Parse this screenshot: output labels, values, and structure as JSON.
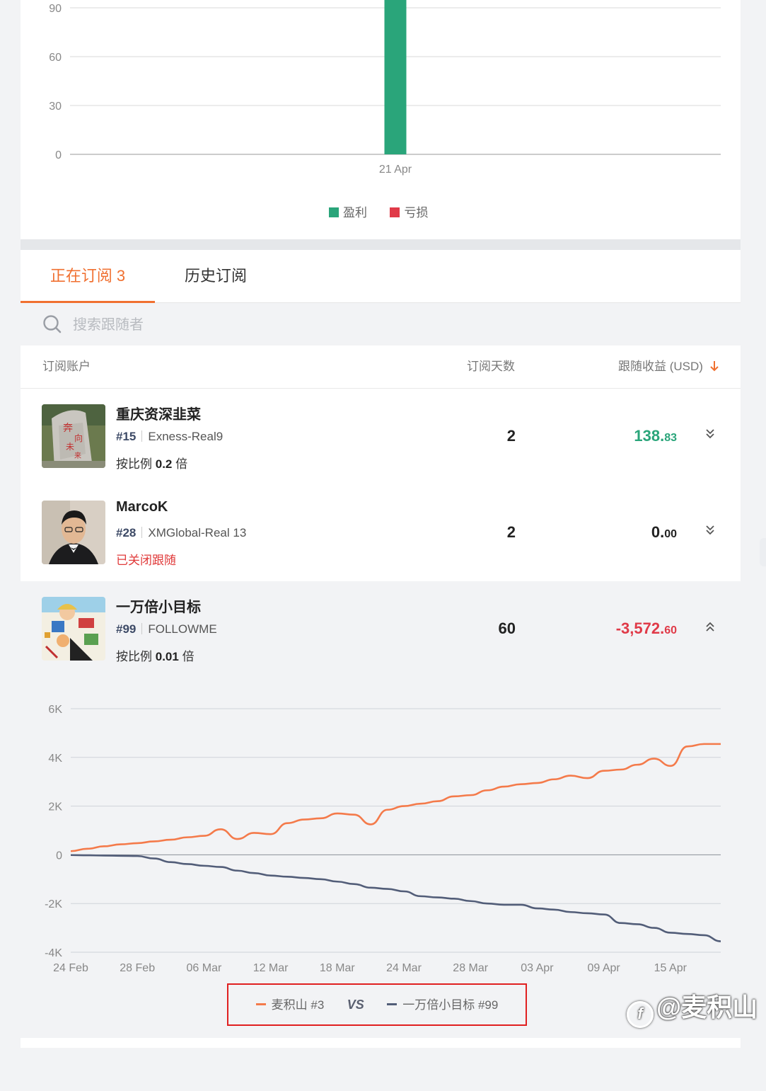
{
  "top_chart": {
    "y_ticks": [
      "90",
      "60",
      "30",
      "0"
    ],
    "x_label": "21 Apr",
    "bar_value": 90,
    "legend": [
      {
        "label": "盈利",
        "color": "#2aa57a"
      },
      {
        "label": "亏损",
        "color": "#e03a48"
      }
    ]
  },
  "tabs": [
    {
      "label": "正在订阅 3",
      "active": true
    },
    {
      "label": "历史订阅",
      "active": false
    }
  ],
  "search": {
    "placeholder": "搜索跟随者",
    "icon": "search-icon"
  },
  "table": {
    "headers": {
      "account": "订阅账户",
      "days": "订阅天数",
      "profit": "跟随收益 (USD)"
    },
    "sort_icon": "arrow-down-icon",
    "rows": [
      {
        "name": "重庆资深韭菜",
        "rank": "#15",
        "broker": "Exness-Real9",
        "ratio_prefix": "按比例",
        "ratio_value": "0.2",
        "ratio_suffix": "倍",
        "days": "2",
        "profit_int": "138.",
        "profit_dec": "83",
        "profit_color": "#2aa57a",
        "toggle": "»",
        "toggle_icon": "chevron-double-down-icon"
      },
      {
        "name": "MarcoK",
        "rank": "#28",
        "broker": "XMGlobal-Real 13",
        "status": "已关闭跟随",
        "days": "2",
        "profit_int": "0.",
        "profit_dec": "00",
        "profit_color": "#222222",
        "toggle": "»",
        "toggle_icon": "chevron-double-down-icon"
      },
      {
        "name": "一万倍小目标",
        "rank": "#99",
        "broker": "FOLLOWME",
        "ratio_prefix": "按比例",
        "ratio_value": "0.01",
        "ratio_suffix": "倍",
        "days": "60",
        "profit_int": "-3,572.",
        "profit_dec": "60",
        "profit_color": "#e03a48",
        "toggle": "»",
        "toggle_icon": "chevron-double-up-icon"
      }
    ]
  },
  "comparison_legend": {
    "series_a": "麦积山 #3",
    "vs": "VS",
    "series_b": "一万倍小目标 #99",
    "highlight_color": "#e02020"
  },
  "watermark": "@麦积山",
  "chart_data": [
    {
      "type": "bar",
      "categories": [
        "21 Apr"
      ],
      "series": [
        {
          "name": "盈利",
          "values": [
            90
          ],
          "color": "#2aa57a"
        },
        {
          "name": "亏损",
          "values": [
            0
          ],
          "color": "#e03a48"
        }
      ],
      "ylim": [
        0,
        90
      ],
      "yticks": [
        0,
        30,
        60,
        90
      ],
      "grid": true,
      "legend": "bottom"
    },
    {
      "type": "line",
      "x_tick_labels": [
        "24 Feb",
        "28 Feb",
        "06 Mar",
        "12 Mar",
        "18 Mar",
        "24 Mar",
        "28 Mar",
        "03 Apr",
        "09 Apr",
        "15 Apr"
      ],
      "y_tick_labels": [
        "6K",
        "4K",
        "2K",
        "0",
        "-2K",
        "-4K"
      ],
      "ylim": [
        -4000,
        6000
      ],
      "grid": true,
      "legend": "bottom",
      "series": [
        {
          "name": "麦积山 #3",
          "color": "#f47a4a",
          "values": [
            150,
            250,
            350,
            430,
            480,
            550,
            620,
            720,
            780,
            1050,
            650,
            900,
            850,
            1300,
            1450,
            1500,
            1700,
            1650,
            1250,
            1850,
            2000,
            2100,
            2200,
            2400,
            2450,
            2650,
            2800,
            2900,
            2950,
            3100,
            3250,
            3150,
            3450,
            3500,
            3700,
            3950,
            3650,
            4450,
            4550,
            4550
          ]
        },
        {
          "name": "一万倍小目标 #99",
          "color": "#525d78",
          "values": [
            -10,
            -20,
            -30,
            -40,
            -50,
            -150,
            -300,
            -380,
            -450,
            -500,
            -650,
            -750,
            -850,
            -900,
            -950,
            -1000,
            -1100,
            -1200,
            -1350,
            -1400,
            -1500,
            -1700,
            -1750,
            -1800,
            -1900,
            -2000,
            -2050,
            -2050,
            -2200,
            -2250,
            -2350,
            -2400,
            -2450,
            -2800,
            -2850,
            -3000,
            -3200,
            -3250,
            -3300,
            -3550
          ]
        }
      ]
    }
  ]
}
